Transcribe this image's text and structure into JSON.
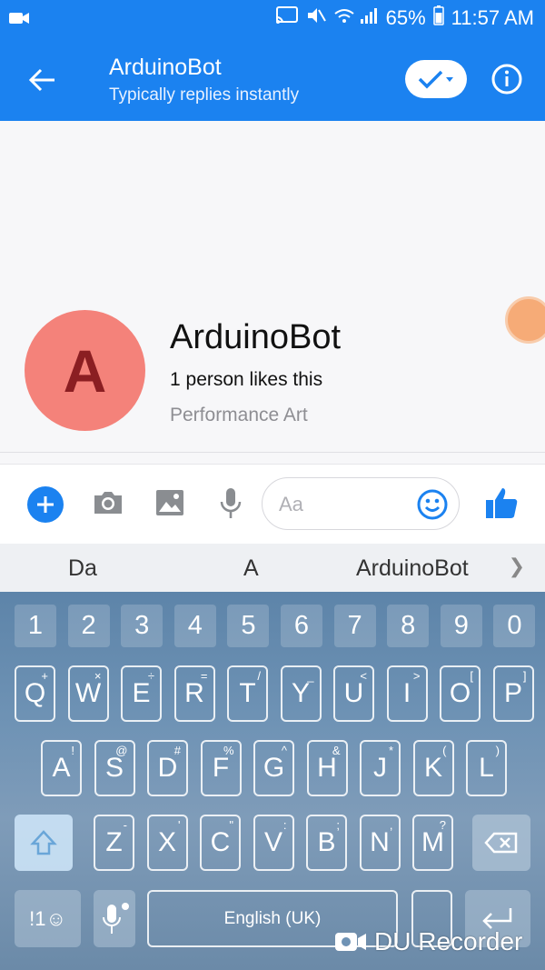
{
  "status_bar": {
    "battery": "65%",
    "time": "11:57 AM"
  },
  "header": {
    "title": "ArduinoBot",
    "subtitle": "Typically replies instantly"
  },
  "profile": {
    "avatar_letter": "A",
    "name": "ArduinoBot",
    "likes": "1 person likes this",
    "category": "Performance Art"
  },
  "composer": {
    "placeholder": "Aa"
  },
  "suggestions": [
    "Da",
    "A",
    "ArduinoBot"
  ],
  "keyboard": {
    "numbers": [
      "1",
      "2",
      "3",
      "4",
      "5",
      "6",
      "7",
      "8",
      "9",
      "0"
    ],
    "row1": [
      {
        "k": "Q",
        "s": "+"
      },
      {
        "k": "W",
        "s": "×"
      },
      {
        "k": "E",
        "s": "÷"
      },
      {
        "k": "R",
        "s": "="
      },
      {
        "k": "T",
        "s": "/"
      },
      {
        "k": "Y",
        "s": "_"
      },
      {
        "k": "U",
        "s": "<"
      },
      {
        "k": "I",
        "s": ">"
      },
      {
        "k": "O",
        "s": "["
      },
      {
        "k": "P",
        "s": "]"
      }
    ],
    "row2": [
      {
        "k": "A",
        "s": "!"
      },
      {
        "k": "S",
        "s": "@"
      },
      {
        "k": "D",
        "s": "#"
      },
      {
        "k": "F",
        "s": "%"
      },
      {
        "k": "G",
        "s": "^"
      },
      {
        "k": "H",
        "s": "&"
      },
      {
        "k": "J",
        "s": "*"
      },
      {
        "k": "K",
        "s": "("
      },
      {
        "k": "L",
        "s": ")"
      }
    ],
    "row3": [
      {
        "k": "Z",
        "s": "-"
      },
      {
        "k": "X",
        "s": "'"
      },
      {
        "k": "C",
        "s": "\""
      },
      {
        "k": "V",
        "s": ":"
      },
      {
        "k": "B",
        "s": ";"
      },
      {
        "k": "N",
        "s": ","
      },
      {
        "k": "M",
        "s": "?"
      }
    ],
    "sym_label": "!1☺",
    "space_label": "English (UK)"
  },
  "watermark": "DU Recorder",
  "colors": {
    "brand": "#1b82f0",
    "avatar": "#f4827a",
    "avatar_letter": "#8b1e22"
  }
}
